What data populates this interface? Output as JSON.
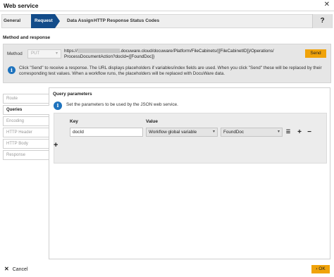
{
  "window": {
    "title": "Web service",
    "close_glyph": "✕"
  },
  "steps": {
    "items": [
      {
        "label": "General"
      },
      {
        "label": "Request"
      },
      {
        "label": "Data Assign"
      },
      {
        "label": "HTTP Response Status Codes"
      }
    ],
    "active": "Request",
    "help_label": "?"
  },
  "method_section": {
    "title": "Method and response",
    "method_label": "Method",
    "method_value": "PUT",
    "url_prefix": "https://",
    "url_rest": ".docuware.cloud/docuware/Platform/FileCabinets/{[FileCabinetID]}/Operations/",
    "url_line2": "ProcessDocumentAction?docId={[FoundDoc]}",
    "send_label": "Send",
    "info_text": "Click \"Send\" to receive a response. The URL displays placeholders if variables/index fields are used. When you click \"Send\" these will be replaced by their corresponding test values. When a workflow runs, the placeholders will be replaced with DocuWare data."
  },
  "side_tabs": [
    {
      "label": "Route"
    },
    {
      "label": "Queries"
    },
    {
      "label": "Encoding"
    },
    {
      "label": "HTTP Header"
    },
    {
      "label": "HTTP Body"
    },
    {
      "label": "Response"
    }
  ],
  "active_side_tab": "Queries",
  "query_params": {
    "title": "Query parameters",
    "info_text": "Set the parameters to be used by the JSON web service.",
    "col_key": "Key",
    "col_value": "Value",
    "rows": [
      {
        "key": "docId",
        "value_type": "Workflow global variable",
        "value": "FoundDoc"
      }
    ]
  },
  "footer": {
    "cancel_label": "Cancel",
    "ok_label": "OK"
  },
  "colors": {
    "accent": "#134c8a",
    "action": "#f0a30a",
    "info": "#1e73be"
  },
  "icons": [
    "close-icon",
    "help-icon",
    "info-icon",
    "chevron-down-icon",
    "list-icon",
    "plus-icon",
    "minus-icon",
    "cancel-x-icon",
    "chevron-right-icon"
  ]
}
